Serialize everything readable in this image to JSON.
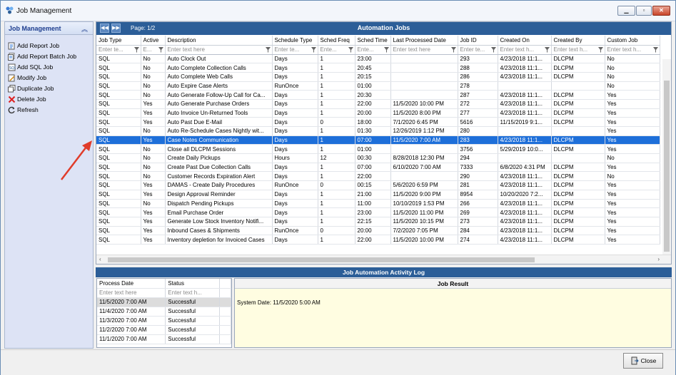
{
  "window": {
    "title": "Job Management"
  },
  "sidebar": {
    "header": "Job Management",
    "actions": [
      {
        "label": "Add Report Job",
        "icon": "add-report-icon"
      },
      {
        "label": "Add Report Batch Job",
        "icon": "add-batch-icon"
      },
      {
        "label": "Add SQL Job",
        "icon": "add-sql-icon"
      },
      {
        "label": "Modify Job",
        "icon": "edit-icon"
      },
      {
        "label": "Duplicate Job",
        "icon": "duplicate-icon"
      },
      {
        "label": "Delete Job",
        "icon": "delete-icon"
      },
      {
        "label": "Refresh",
        "icon": "refresh-icon"
      }
    ]
  },
  "grid": {
    "title": "Automation Jobs",
    "page": "Page: 1/2",
    "filter_placeholders": [
      "Enter te...",
      "E...",
      "Enter text here",
      "Enter te...",
      "Ente...",
      "Ente...",
      "Enter text here",
      "Enter te...",
      "Enter text h...",
      "Enter text h...",
      "Enter text h..."
    ],
    "columns": [
      "Job Type",
      "Active",
      "Description",
      "Schedule Type",
      "Sched Freq",
      "Sched Time",
      "Last Processed Date",
      "Job ID",
      "Created On",
      "Created By",
      "Custom Job"
    ],
    "rows": [
      [
        "SQL",
        "No",
        "Auto Clock Out",
        "Days",
        "1",
        "23:00",
        "",
        "293",
        "4/23/2018 11:1...",
        "DLCPM",
        "No"
      ],
      [
        "SQL",
        "No",
        "Auto Complete Collection Calls",
        "Days",
        "1",
        "20:45",
        "",
        "288",
        "4/23/2018 11:1...",
        "DLCPM",
        "No"
      ],
      [
        "SQL",
        "No",
        "Auto Complete Web Calls",
        "Days",
        "1",
        "20:15",
        "",
        "286",
        "4/23/2018 11:1...",
        "DLCPM",
        "No"
      ],
      [
        "SQL",
        "No",
        "Auto Expire Case Alerts",
        "RunOnce",
        "1",
        "01:00",
        "",
        "278",
        "",
        "",
        "No"
      ],
      [
        "SQL",
        "No",
        "Auto Generate Follow-Up Call for Ca...",
        "Days",
        "1",
        "20:30",
        "",
        "287",
        "4/23/2018 11:1...",
        "DLCPM",
        "Yes"
      ],
      [
        "SQL",
        "Yes",
        "Auto Generate Purchase Orders",
        "Days",
        "1",
        "22:00",
        "11/5/2020 10:00 PM",
        "272",
        "4/23/2018 11:1...",
        "DLCPM",
        "Yes"
      ],
      [
        "SQL",
        "Yes",
        "Auto Invoice Un-Returned Tools",
        "Days",
        "1",
        "20:00",
        "11/5/2020 8:00 PM",
        "277",
        "4/23/2018 11:1...",
        "DLCPM",
        "Yes"
      ],
      [
        "SQL",
        "Yes",
        "Auto Past Due E-Mail",
        "Days",
        "0",
        "18:00",
        "7/1/2020 6:45 PM",
        "5616",
        "11/15/2019 9:1...",
        "DLCPM",
        "Yes"
      ],
      [
        "SQL",
        "No",
        "Auto Re-Schedule Cases Nightly wit...",
        "Days",
        "1",
        "01:30",
        "12/26/2019 1:12 PM",
        "280",
        "",
        "",
        "Yes"
      ],
      [
        "SQL",
        "Yes",
        "Case Notes Communication",
        "Days",
        "1",
        "07:00",
        "11/5/2020 7:00 AM",
        "283",
        "4/23/2018 11:1...",
        "DLCPM",
        "Yes"
      ],
      [
        "SQL",
        "No",
        "Close all DLCPM Sessions",
        "Days",
        "1",
        "01:00",
        "",
        "3756",
        "5/29/2019 10:0...",
        "DLCPM",
        "Yes"
      ],
      [
        "SQL",
        "No",
        "Create Daily Pickups",
        "Hours",
        "12",
        "00:30",
        "8/28/2018 12:30 PM",
        "294",
        "",
        "",
        "No"
      ],
      [
        "SQL",
        "No",
        "Create Past Due Collection Calls",
        "Days",
        "1",
        "07:00",
        "6/10/2020 7:00 AM",
        "7333",
        "6/8/2020 4:31 PM",
        "DLCPM",
        "Yes"
      ],
      [
        "SQL",
        "No",
        "Customer Records Expiration Alert",
        "Days",
        "1",
        "22:00",
        "",
        "290",
        "4/23/2018 11:1...",
        "DLCPM",
        "No"
      ],
      [
        "SQL",
        "Yes",
        "DAMAS - Create Daily Procedures",
        "RunOnce",
        "0",
        "00:15",
        "5/6/2020 6:59 PM",
        "281",
        "4/23/2018 11:1...",
        "DLCPM",
        "Yes"
      ],
      [
        "SQL",
        "Yes",
        "Design Approval Reminder",
        "Days",
        "1",
        "21:00",
        "11/5/2020 9:00 PM",
        "8954",
        "10/20/2020 7:2...",
        "DLCPM",
        "Yes"
      ],
      [
        "SQL",
        "No",
        "Dispatch Pending Pickups",
        "Days",
        "1",
        "11:00",
        "10/10/2019 1:53 PM",
        "266",
        "4/23/2018 11:1...",
        "DLCPM",
        "Yes"
      ],
      [
        "SQL",
        "Yes",
        "Email Purchase Order",
        "Days",
        "1",
        "23:00",
        "11/5/2020 11:00 PM",
        "269",
        "4/23/2018 11:1...",
        "DLCPM",
        "Yes"
      ],
      [
        "SQL",
        "Yes",
        "Generate Low Stock Inventory Notifi...",
        "Days",
        "1",
        "22:15",
        "11/5/2020 10:15 PM",
        "273",
        "4/23/2018 11:1...",
        "DLCPM",
        "Yes"
      ],
      [
        "SQL",
        "Yes",
        "Inbound Cases & Shipments",
        "RunOnce",
        "0",
        "20:00",
        "7/2/2020 7:05 PM",
        "284",
        "4/23/2018 11:1...",
        "DLCPM",
        "Yes"
      ],
      [
        "SQL",
        "Yes",
        "Inventory depletion for Invoiced Cases",
        "Days",
        "1",
        "22:00",
        "11/5/2020 10:00 PM",
        "274",
        "4/23/2018 11:1...",
        "DLCPM",
        "Yes"
      ]
    ]
  },
  "log": {
    "title": "Job Automation Activity Log",
    "columns": [
      "Process Date",
      "Status"
    ],
    "filter_placeholders": [
      "Enter text here",
      "Enter text h..."
    ],
    "rows": [
      [
        "11/5/2020 7:00 AM",
        "Successful"
      ],
      [
        "11/4/2020 7:00 AM",
        "Successful"
      ],
      [
        "11/3/2020 7:00 AM",
        "Successful"
      ],
      [
        "11/2/2020 7:00 AM",
        "Successful"
      ],
      [
        "11/1/2020 7:00 AM",
        "Successful"
      ]
    ],
    "result_header": "Job Result",
    "result_text": "System Date: 11/5/2020 5:00 AM"
  },
  "footer": {
    "close_label": "Close"
  },
  "colors": {
    "accent": "#2c5e98",
    "selection": "#1e6fd9",
    "result_bg": "#fffde1",
    "arrow": "#e03c2a"
  }
}
